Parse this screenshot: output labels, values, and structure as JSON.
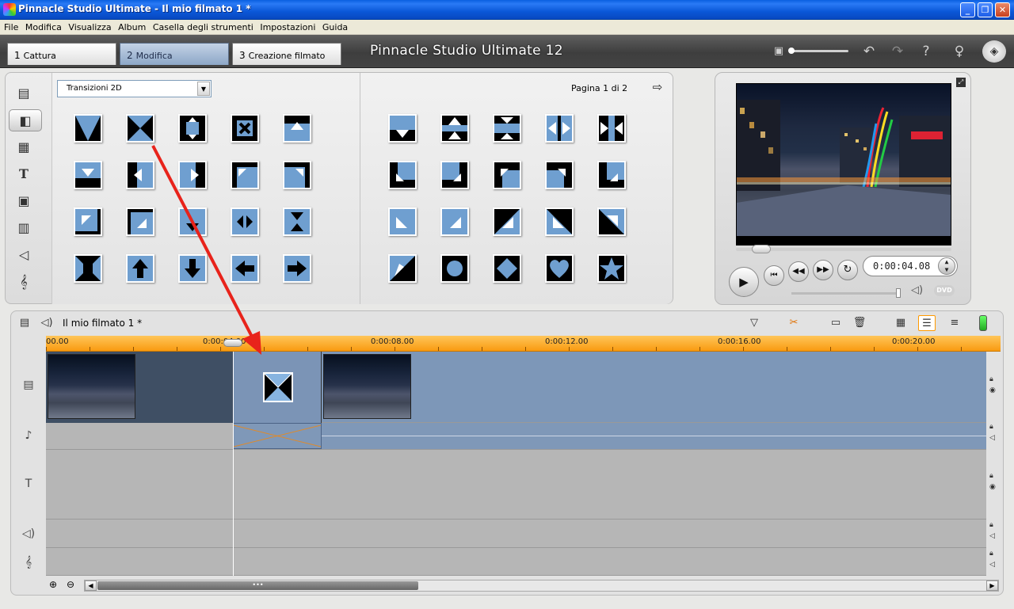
{
  "window": {
    "title": "Pinnacle Studio Ultimate - Il mio filmato 1 *"
  },
  "menu": [
    "File",
    "Modifica",
    "Visualizza",
    "Album",
    "Casella degli strumenti",
    "Impostazioni",
    "Guida"
  ],
  "modes": [
    {
      "num": "1",
      "label": "Cattura"
    },
    {
      "num": "2",
      "label": "Modifica"
    },
    {
      "num": "3",
      "label": "Creazione filmato"
    }
  ],
  "app_title": "Pinnacle Studio Ultimate 12",
  "album": {
    "category": "Transizioni 2D",
    "page_info": "Pagina 1 di 2"
  },
  "player": {
    "timecode": "0:00:04.08",
    "dvd_label": "DVD"
  },
  "timeline": {
    "project_name": "Il mio filmato 1 *",
    "ticks": [
      "00.00",
      "0:00:04.00",
      "0:00:08.00",
      "0:00:12.00",
      "0:00:16.00",
      "0:00:20.00"
    ]
  },
  "colors": {
    "accent": "#f99b10",
    "selected_tab": "#8da7c7",
    "video_track": "#7d97b8",
    "annotation_arrow": "#e8231b"
  }
}
